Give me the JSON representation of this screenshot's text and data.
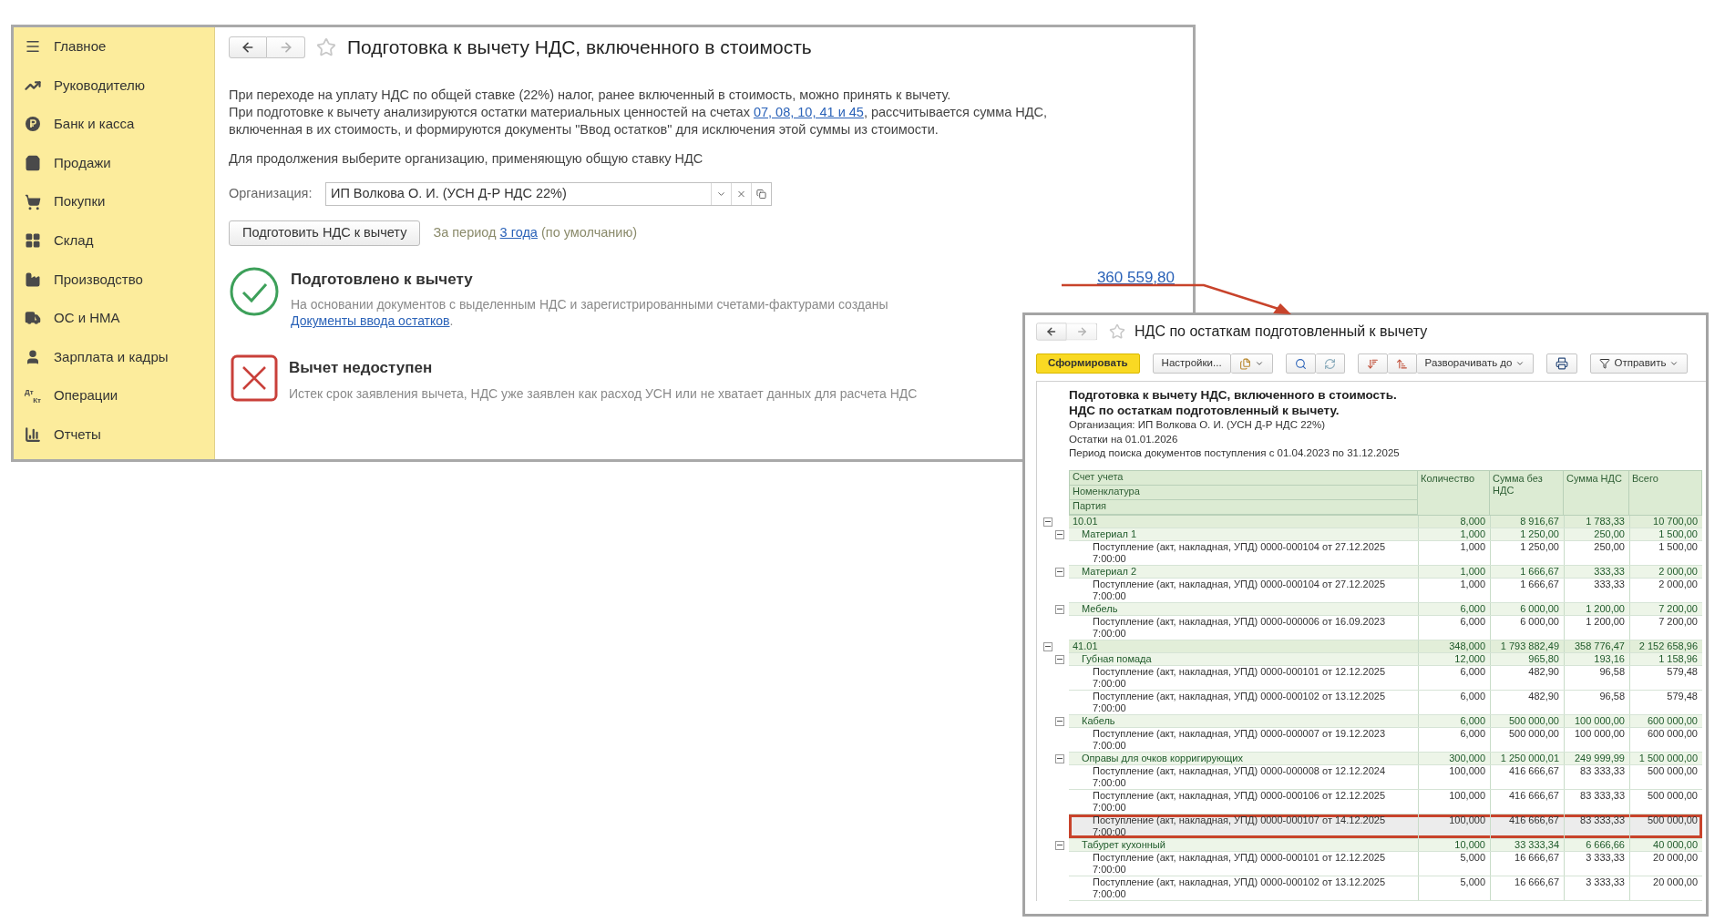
{
  "sidebar": {
    "items": [
      {
        "label": "Главное",
        "kind": "menu"
      },
      {
        "label": "Руководителю",
        "kind": "trend"
      },
      {
        "label": "Банк и касса",
        "kind": "coin"
      },
      {
        "label": "Продажи",
        "kind": "bag"
      },
      {
        "label": "Покупки",
        "kind": "cart"
      },
      {
        "label": "Склад",
        "kind": "grid"
      },
      {
        "label": "Производство",
        "kind": "factory"
      },
      {
        "label": "ОС и НМА",
        "kind": "truck"
      },
      {
        "label": "Зарплата и кадры",
        "kind": "person"
      },
      {
        "label": "Операции",
        "kind": "letters",
        "icon_text": [
          "Дт",
          "Кт"
        ]
      },
      {
        "label": "Отчеты",
        "kind": "bars"
      }
    ]
  },
  "main_window": {
    "title": "Подготовка к вычету НДС, включенного в стоимость",
    "intro": {
      "line_1": "При переходе на уплату НДС по общей ставке (22%) налог, ранее включенный в стоимость, можно принять к вычету.",
      "before_link": "При подготовке к вычету анализируются остатки материальных ценностей на счетах ",
      "link": "07, 08, 10, 41 и 45",
      "after_link": ", рассчитывается сумма НДС, включенная в их стоимость, и формируются документы \"Ввод остатков\" для исключения этой суммы из стоимости."
    },
    "prompt": "Для продолжения выберите организацию, применяющую общую ставку НДС",
    "organization": {
      "label": "Организация:",
      "value": "ИП Волкова О. И. (УСН Д-Р НДС 22%)"
    },
    "prepare_button": "Подготовить НДС к вычету",
    "period": {
      "before": "За период ",
      "link": "3 года",
      "after": " (по умолчанию)"
    },
    "results": [
      {
        "kind": "success",
        "title": "Подготовлено к вычету",
        "description": "На основании документов с выделенным НДС и зарегистрированными счетами-фактурами созданы",
        "link": "Документы ввода остатков",
        "link_after": ".",
        "amount": "360 559,80"
      },
      {
        "kind": "failure",
        "title": "Вычет недоступен",
        "description": "Истек срок заявления вычета, НДС уже заявлен как расход УСН или не хватает данных для расчета НДС"
      }
    ]
  },
  "report_window": {
    "title": "НДС по остаткам подготовленный к вычету",
    "toolbar": [
      {
        "kind": "primary",
        "label": "Сформировать"
      },
      {
        "kind": "settings",
        "label": "Настройки..."
      },
      {
        "kind": "search"
      },
      {
        "kind": "expand",
        "label": "Разворачивать до"
      },
      {
        "kind": "print"
      },
      {
        "kind": "send",
        "label": "Отправить"
      }
    ],
    "report_title": [
      "Подготовка к вычету НДС, включенного в стоимость.",
      "НДС по остаткам подготовленный к вычету."
    ],
    "report_info": [
      "Организация: ИП Волкова О. И. (УСН Д-Р НДС 22%)",
      "Остатки на 01.01.2026",
      "Период поиска документов поступления с 01.04.2023 по 31.12.2025"
    ],
    "columns": {
      "first": [
        "Счет учета",
        "Номенклатура",
        "Партия"
      ],
      "rest": [
        "Количество",
        "Сумма без НДС",
        "Сумма НДС",
        "Всего"
      ]
    },
    "rows": [
      {
        "label": "10.01",
        "values": [
          "8,000",
          "8 916,67",
          "1 783,33",
          "10 700,00"
        ],
        "expanded": true,
        "children": [
          {
            "label": "Материал 1",
            "values": [
              "1,000",
              "1 250,00",
              "250,00",
              "1 500,00"
            ],
            "expanded": true,
            "children": [
              {
                "label": "Поступление (акт, накладная, УПД) 0000-000104 от 27.12.2025 7:00:00",
                "values": [
                  "1,000",
                  "1 250,00",
                  "250,00",
                  "1 500,00"
                ],
                "selected": false
              }
            ]
          },
          {
            "label": "Материал 2",
            "values": [
              "1,000",
              "1 666,67",
              "333,33",
              "2 000,00"
            ],
            "expanded": true,
            "children": [
              {
                "label": "Поступление (акт, накладная, УПД) 0000-000104 от 27.12.2025 7:00:00",
                "values": [
                  "1,000",
                  "1 666,67",
                  "333,33",
                  "2 000,00"
                ],
                "selected": false
              }
            ]
          },
          {
            "label": "Мебель",
            "values": [
              "6,000",
              "6 000,00",
              "1 200,00",
              "7 200,00"
            ],
            "expanded": true,
            "children": [
              {
                "label": "Поступление (акт, накладная, УПД) 0000-000006 от 16.09.2023 7:00:00",
                "values": [
                  "6,000",
                  "6 000,00",
                  "1 200,00",
                  "7 200,00"
                ],
                "selected": false
              }
            ]
          }
        ]
      },
      {
        "label": "41.01",
        "values": [
          "348,000",
          "1 793 882,49",
          "358 776,47",
          "2 152 658,96"
        ],
        "expanded": true,
        "children": [
          {
            "label": "Губная помада",
            "values": [
              "12,000",
              "965,80",
              "193,16",
              "1 158,96"
            ],
            "expanded": true,
            "children": [
              {
                "label": "Поступление (акт, накладная, УПД) 0000-000101 от 12.12.2025 7:00:00",
                "values": [
                  "6,000",
                  "482,90",
                  "96,58",
                  "579,48"
                ],
                "selected": false
              },
              {
                "label": "Поступление (акт, накладная, УПД) 0000-000102 от 13.12.2025 7:00:00",
                "values": [
                  "6,000",
                  "482,90",
                  "96,58",
                  "579,48"
                ],
                "selected": false
              }
            ]
          },
          {
            "label": "Кабель",
            "values": [
              "6,000",
              "500 000,00",
              "100 000,00",
              "600 000,00"
            ],
            "expanded": true,
            "children": [
              {
                "label": "Поступление (акт, накладная, УПД) 0000-000007 от 19.12.2023 7:00:00",
                "values": [
                  "6,000",
                  "500 000,00",
                  "100 000,00",
                  "600 000,00"
                ],
                "selected": false
              }
            ]
          },
          {
            "label": "Оправы для очков корригирующих",
            "values": [
              "300,000",
              "1 250 000,01",
              "249 999,99",
              "1 500 000,00"
            ],
            "expanded": true,
            "children": [
              {
                "label": "Поступление (акт, накладная, УПД) 0000-000008 от 12.12.2024 7:00:00",
                "values": [
                  "100,000",
                  "416 666,67",
                  "83 333,33",
                  "500 000,00"
                ],
                "selected": false
              },
              {
                "label": "Поступление (акт, накладная, УПД) 0000-000106 от 12.12.2025 7:00:00",
                "values": [
                  "100,000",
                  "416 666,67",
                  "83 333,33",
                  "500 000,00"
                ],
                "selected": false
              },
              {
                "label": "Поступление (акт, накладная, УПД) 0000-000107 от 14.12.2025 7:00:00",
                "values": [
                  "100,000",
                  "416 666,67",
                  "83 333,33",
                  "500 000,00"
                ],
                "selected": true
              }
            ]
          },
          {
            "label": "Табурет кухонный",
            "values": [
              "10,000",
              "33 333,34",
              "6 666,66",
              "40 000,00"
            ],
            "expanded": true,
            "children": [
              {
                "label": "Поступление (акт, накладная, УПД) 0000-000101 от 12.12.2025 7:00:00",
                "values": [
                  "5,000",
                  "16 666,67",
                  "3 333,33",
                  "20 000,00"
                ],
                "selected": false
              },
              {
                "label": "Поступление (акт, накладная, УПД) 0000-000102 от 13.12.2025 7:00:00",
                "values": [
                  "5,000",
                  "16 666,67",
                  "3 333,33",
                  "20 000,00"
                ],
                "selected": false
              }
            ]
          }
        ]
      }
    ]
  }
}
